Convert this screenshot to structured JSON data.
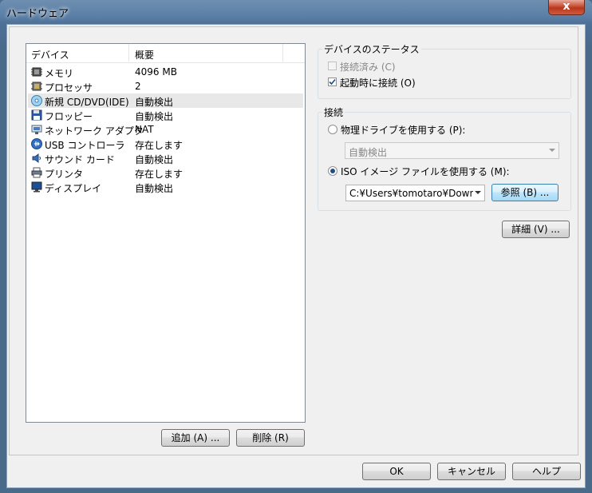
{
  "window": {
    "title": "ハードウェア",
    "close_label": "x"
  },
  "devices": {
    "header": {
      "device": "デバイス",
      "summary": "概要"
    },
    "items": [
      {
        "icon": "memory-icon",
        "name": "メモリ",
        "value": "4096 MB"
      },
      {
        "icon": "cpu-icon",
        "name": "プロセッサ",
        "value": "2"
      },
      {
        "icon": "cd-dvd-icon",
        "name": "新規 CD/DVD(IDE)",
        "value": "自動検出",
        "selected": true
      },
      {
        "icon": "floppy-icon",
        "name": "フロッピー",
        "value": "自動検出"
      },
      {
        "icon": "network-adapter-icon",
        "name": "ネットワーク アダプタ",
        "value": "NAT"
      },
      {
        "icon": "usb-icon",
        "name": "USB コントローラ",
        "value": "存在します"
      },
      {
        "icon": "sound-card-icon",
        "name": "サウンド カード",
        "value": "自動検出"
      },
      {
        "icon": "printer-icon",
        "name": "プリンタ",
        "value": "存在します"
      },
      {
        "icon": "display-icon",
        "name": "ディスプレイ",
        "value": "自動検出"
      }
    ],
    "add_label": "追加 (A) ...",
    "remove_label": "削除 (R)"
  },
  "status": {
    "title": "デバイスのステータス",
    "connected_label": "接続済み (C)",
    "connected_checked": false,
    "connect_at_power_on_label": "起動時に接続 (O)",
    "connect_at_power_on_checked": true
  },
  "connection": {
    "title": "接続",
    "physical_label": "物理ドライブを使用する (P):",
    "physical_value": "自動検出",
    "iso_label": "ISO イメージ ファイルを使用する (M):",
    "iso_value": "C:¥Users¥tomotaro¥Downlc",
    "browse_label": "参照 (B) ...",
    "selected": "iso"
  },
  "advanced_label": "詳細 (V) ...",
  "footer": {
    "ok": "OK",
    "cancel": "キャンセル",
    "help": "ヘルプ"
  }
}
